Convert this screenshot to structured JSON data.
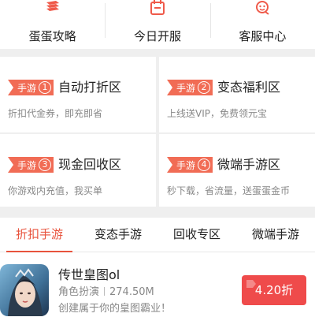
{
  "topnav": {
    "items": [
      {
        "label": "蛋蛋攻略",
        "icon": "guide-stack-icon"
      },
      {
        "label": "今日开服",
        "icon": "calendar-icon"
      },
      {
        "label": "客服中心",
        "icon": "customer-service-icon"
      }
    ]
  },
  "features": [
    {
      "tag": "手游",
      "num": "1",
      "title": "自动打折区",
      "desc": "折扣代金券，即充即省"
    },
    {
      "tag": "手游",
      "num": "2",
      "title": "变态福利区",
      "desc": "上线送VIP，免费领元宝"
    },
    {
      "tag": "手游",
      "num": "3",
      "title": "现金回收区",
      "desc": "你游戏内充值，我买单"
    },
    {
      "tag": "手游",
      "num": "4",
      "title": "微端手游区",
      "desc": "秒下载，省流量，送蛋蛋金币"
    }
  ],
  "tabs": [
    {
      "label": "折扣手游",
      "active": true
    },
    {
      "label": "变态手游"
    },
    {
      "label": "回收专区"
    },
    {
      "label": "微端手游"
    }
  ],
  "game": {
    "name": "传世皇图ol",
    "genre": "角色扮演",
    "size": "274.50M",
    "desc": "创建属于你的皇图霸业！",
    "discount": "4.20折"
  },
  "colors": {
    "accent": "#e8533d",
    "tag": "#f16c55",
    "discount_button": "#ef4b4b"
  }
}
